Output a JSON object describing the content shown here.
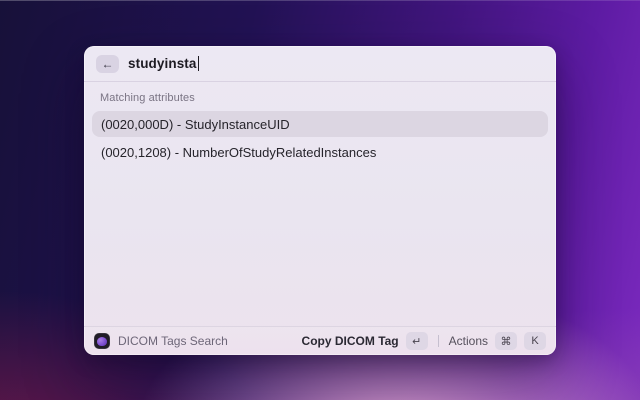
{
  "window": {
    "search": {
      "back_icon": "←",
      "value": "studyinsta"
    },
    "section_header": "Matching attributes",
    "results": [
      {
        "label": "(0020,000D) - StudyInstanceUID",
        "selected": true
      },
      {
        "label": "(0020,1208) - NumberOfStudyRelatedInstances",
        "selected": false
      }
    ],
    "footer": {
      "app_icon": "brain-logo-icon",
      "app_name": "DICOM Tags Search",
      "primary_action": "Copy DICOM Tag",
      "primary_key": "↵",
      "actions_label": "Actions",
      "actions_keys": [
        "⌘",
        "K"
      ]
    }
  },
  "colors": {
    "selection_bg": "#dcd6e2",
    "window_bg": "#ece7f1",
    "wallpaper_top_left": "#171139",
    "wallpaper_right": "#7c2abf",
    "wallpaper_bottom_pink": "#e8add8",
    "wallpaper_bottom_maroon": "#71184a"
  }
}
